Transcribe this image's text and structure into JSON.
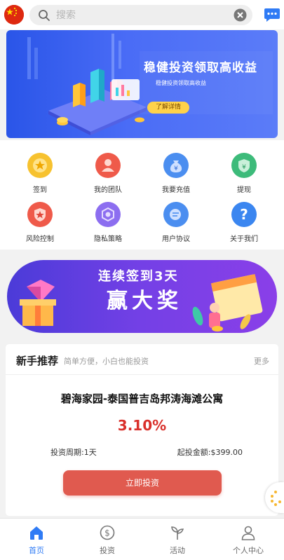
{
  "search": {
    "placeholder": "搜索"
  },
  "banner": {
    "title": "稳健投资领取高收益",
    "subtitle": "稳健投资领取高收益",
    "button": "了解详情"
  },
  "menu": [
    {
      "label": "签到",
      "icon": "medal-icon",
      "color": "#f7c22f"
    },
    {
      "label": "我的团队",
      "icon": "team-icon",
      "color": "#ef5a4a"
    },
    {
      "label": "我要充值",
      "icon": "money-bag-icon",
      "color": "#4b8ef0"
    },
    {
      "label": "提现",
      "icon": "withdraw-shield-icon",
      "color": "#3dbb7a"
    },
    {
      "label": "风险控制",
      "icon": "star-shield-icon",
      "color": "#ef5a4a"
    },
    {
      "label": "隐私策略",
      "icon": "privacy-icon",
      "color": "#8c6ef0"
    },
    {
      "label": "用户协议",
      "icon": "agreement-icon",
      "color": "#4b8ef0"
    },
    {
      "label": "关于我们",
      "icon": "question-icon",
      "color": "#3b86f0"
    }
  ],
  "sign_banner": {
    "line1": "连续签到3天",
    "line2": "赢大奖"
  },
  "recommend": {
    "title": "新手推荐",
    "subtitle": "简单方便，小白也能投资",
    "more": "更多",
    "product_name": "碧海家园-泰国普吉岛邦涛海滩公寓",
    "rate": "3.10%",
    "period": "投资周期:1天",
    "min_amount": "起投金额:$399.00",
    "invest_button": "立即投资"
  },
  "nav": [
    {
      "label": "首页",
      "icon": "home-icon",
      "active": true
    },
    {
      "label": "投资",
      "icon": "coin-icon",
      "active": false
    },
    {
      "label": "活动",
      "icon": "sprout-icon",
      "active": false
    },
    {
      "label": "个人中心",
      "icon": "user-icon",
      "active": false
    }
  ],
  "colors": {
    "accent": "#2f7bf5",
    "rate": "#d9302b",
    "invest_button": "#e05a4f"
  }
}
